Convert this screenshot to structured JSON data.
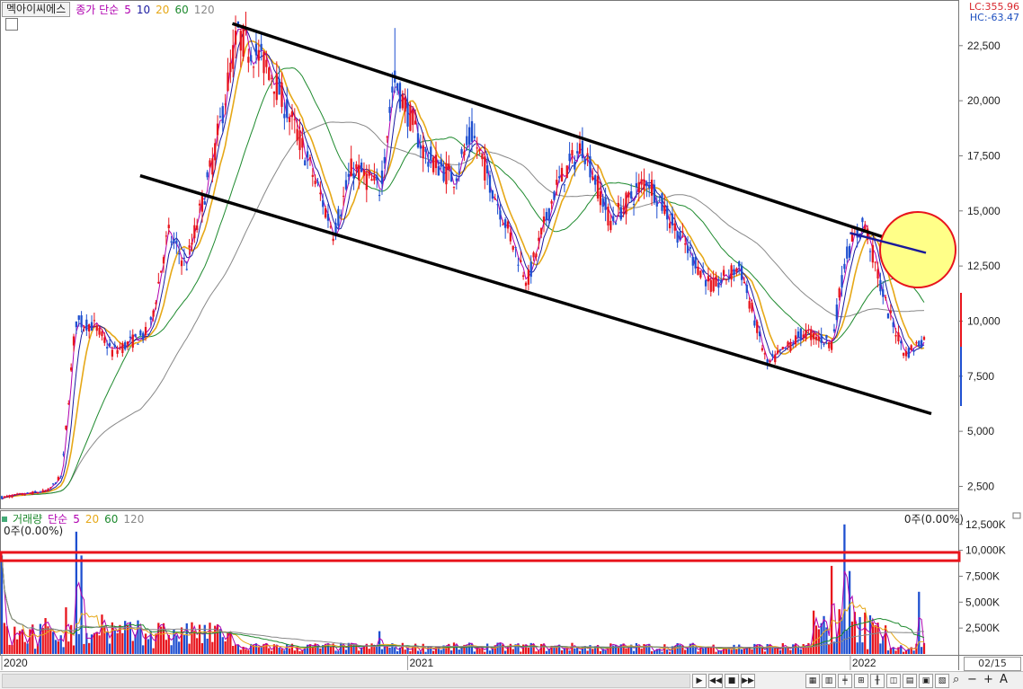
{
  "header": {
    "stock_name": "멕아이씨에스",
    "ma_label": "종가 단순",
    "ma_periods": [
      "5",
      "10",
      "20",
      "60",
      "120"
    ],
    "lc_text": "LC:355.96",
    "hc_text": "HC:-63.47"
  },
  "volume_header": {
    "label": "거래량",
    "ma_label": "단순",
    "ma_periods": [
      "5",
      "20",
      "60",
      "120"
    ],
    "zero_left": "0주(0.00%)",
    "zero_right": "0주(0.00%)"
  },
  "date_display": "02/15",
  "colors": {
    "up": "#e8141c",
    "down": "#1e4fd0",
    "ma5": "#b000b0",
    "ma10": "#1a1aa0",
    "ma20": "#e6a817",
    "ma60": "#1e8a2e",
    "ma120": "#888888",
    "ma_label_colors": [
      "#b000b0",
      "#1a1aa0",
      "#e6a817",
      "#1e8a2e",
      "#888888"
    ],
    "vol_ma_label_colors": [
      "#b000b0",
      "#e6a817",
      "#1e8a2e",
      "#888888"
    ]
  },
  "chart_data": [
    {
      "type": "candlestick",
      "title": "",
      "y_ticks": [
        2500,
        5000,
        7500,
        10000,
        12500,
        15000,
        17500,
        20000,
        22500
      ],
      "y_tick_labels": [
        "2,500",
        "5,000",
        "7,500",
        "10,000",
        "12,500",
        "15,000",
        "17,500",
        "20,000",
        "22,500"
      ],
      "ylim": [
        1500,
        24000
      ],
      "x_tick_labels": [
        "2020",
        "2021",
        "2022"
      ],
      "price_path": [
        {
          "t": 0.0,
          "v": 2000
        },
        {
          "t": 0.05,
          "v": 2300
        },
        {
          "t": 0.065,
          "v": 3000
        },
        {
          "t": 0.08,
          "v": 10000
        },
        {
          "t": 0.1,
          "v": 9800
        },
        {
          "t": 0.12,
          "v": 8600
        },
        {
          "t": 0.16,
          "v": 9500
        },
        {
          "t": 0.18,
          "v": 14000
        },
        {
          "t": 0.2,
          "v": 12500
        },
        {
          "t": 0.23,
          "v": 17500
        },
        {
          "t": 0.255,
          "v": 23000
        },
        {
          "t": 0.29,
          "v": 21500
        },
        {
          "t": 0.33,
          "v": 17500
        },
        {
          "t": 0.36,
          "v": 14000
        },
        {
          "t": 0.38,
          "v": 17000
        },
        {
          "t": 0.41,
          "v": 16000
        },
        {
          "t": 0.425,
          "v": 21000
        },
        {
          "t": 0.46,
          "v": 17500
        },
        {
          "t": 0.49,
          "v": 16500
        },
        {
          "t": 0.51,
          "v": 18500
        },
        {
          "t": 0.55,
          "v": 14000
        },
        {
          "t": 0.57,
          "v": 11800
        },
        {
          "t": 0.6,
          "v": 16000
        },
        {
          "t": 0.63,
          "v": 18000
        },
        {
          "t": 0.66,
          "v": 14500
        },
        {
          "t": 0.7,
          "v": 16500
        },
        {
          "t": 0.74,
          "v": 13500
        },
        {
          "t": 0.77,
          "v": 11500
        },
        {
          "t": 0.8,
          "v": 12500
        },
        {
          "t": 0.83,
          "v": 8000
        },
        {
          "t": 0.87,
          "v": 9500
        },
        {
          "t": 0.9,
          "v": 9000
        },
        {
          "t": 0.915,
          "v": 13000
        },
        {
          "t": 0.935,
          "v": 14500
        },
        {
          "t": 0.96,
          "v": 10500
        },
        {
          "t": 0.98,
          "v": 8500
        },
        {
          "t": 1.0,
          "v": 9200
        }
      ],
      "trendlines": [
        {
          "name": "upper-channel",
          "from": {
            "t": 0.25,
            "v": 23500
          },
          "to": {
            "t": 1.0,
            "v": 13100
          }
        },
        {
          "name": "lower-channel",
          "from": {
            "t": 0.15,
            "v": 16600
          },
          "to": {
            "t": 1.0,
            "v": 5800
          }
        }
      ],
      "annotation_circle": {
        "t": 1.0,
        "v": 13600,
        "color": "#ffff88",
        "border": "#e8141c"
      }
    },
    {
      "type": "bar",
      "title": "",
      "y_ticks": [
        2500,
        5000,
        7500,
        10000,
        12500
      ],
      "y_tick_labels": [
        "2,500K",
        "5,000K",
        "7,500K",
        "10,000K",
        "12,500K"
      ],
      "ylim": [
        0,
        13000
      ],
      "highlight_band": {
        "from": 9000,
        "to": 9800,
        "border": "#e8141c"
      },
      "volume_spikes": [
        {
          "t": 0.0,
          "v": 9500
        },
        {
          "t": 0.08,
          "v": 11800
        },
        {
          "t": 0.085,
          "v": 9500
        },
        {
          "t": 0.07,
          "v": 4500
        },
        {
          "t": 0.11,
          "v": 3800
        },
        {
          "t": 0.17,
          "v": 3000
        },
        {
          "t": 0.22,
          "v": 2800
        },
        {
          "t": 0.41,
          "v": 2200
        },
        {
          "t": 0.9,
          "v": 8500
        },
        {
          "t": 0.915,
          "v": 12500
        },
        {
          "t": 0.92,
          "v": 8000
        },
        {
          "t": 0.995,
          "v": 6000
        }
      ]
    }
  ]
}
